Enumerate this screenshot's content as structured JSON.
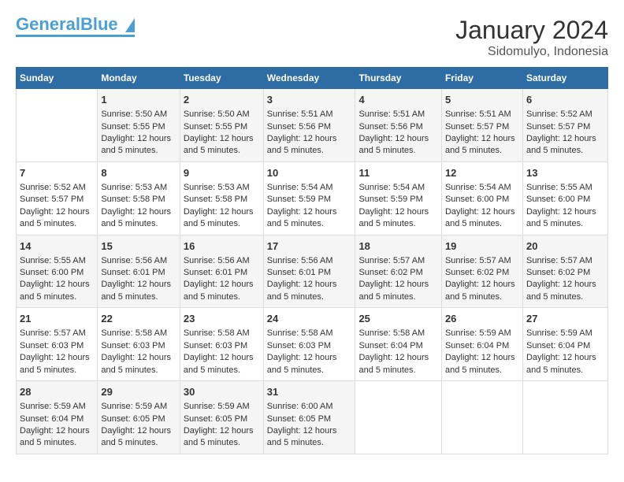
{
  "header": {
    "logo_general": "General",
    "logo_blue": "Blue",
    "month": "January 2024",
    "location": "Sidomulyo, Indonesia"
  },
  "days_of_week": [
    "Sunday",
    "Monday",
    "Tuesday",
    "Wednesday",
    "Thursday",
    "Friday",
    "Saturday"
  ],
  "weeks": [
    [
      {
        "day": "",
        "sunrise": "",
        "sunset": "",
        "daylight": ""
      },
      {
        "day": "1",
        "sunrise": "Sunrise: 5:50 AM",
        "sunset": "Sunset: 5:55 PM",
        "daylight": "Daylight: 12 hours and 5 minutes."
      },
      {
        "day": "2",
        "sunrise": "Sunrise: 5:50 AM",
        "sunset": "Sunset: 5:55 PM",
        "daylight": "Daylight: 12 hours and 5 minutes."
      },
      {
        "day": "3",
        "sunrise": "Sunrise: 5:51 AM",
        "sunset": "Sunset: 5:56 PM",
        "daylight": "Daylight: 12 hours and 5 minutes."
      },
      {
        "day": "4",
        "sunrise": "Sunrise: 5:51 AM",
        "sunset": "Sunset: 5:56 PM",
        "daylight": "Daylight: 12 hours and 5 minutes."
      },
      {
        "day": "5",
        "sunrise": "Sunrise: 5:51 AM",
        "sunset": "Sunset: 5:57 PM",
        "daylight": "Daylight: 12 hours and 5 minutes."
      },
      {
        "day": "6",
        "sunrise": "Sunrise: 5:52 AM",
        "sunset": "Sunset: 5:57 PM",
        "daylight": "Daylight: 12 hours and 5 minutes."
      }
    ],
    [
      {
        "day": "7",
        "sunrise": "Sunrise: 5:52 AM",
        "sunset": "Sunset: 5:57 PM",
        "daylight": "Daylight: 12 hours and 5 minutes."
      },
      {
        "day": "8",
        "sunrise": "Sunrise: 5:53 AM",
        "sunset": "Sunset: 5:58 PM",
        "daylight": "Daylight: 12 hours and 5 minutes."
      },
      {
        "day": "9",
        "sunrise": "Sunrise: 5:53 AM",
        "sunset": "Sunset: 5:58 PM",
        "daylight": "Daylight: 12 hours and 5 minutes."
      },
      {
        "day": "10",
        "sunrise": "Sunrise: 5:54 AM",
        "sunset": "Sunset: 5:59 PM",
        "daylight": "Daylight: 12 hours and 5 minutes."
      },
      {
        "day": "11",
        "sunrise": "Sunrise: 5:54 AM",
        "sunset": "Sunset: 5:59 PM",
        "daylight": "Daylight: 12 hours and 5 minutes."
      },
      {
        "day": "12",
        "sunrise": "Sunrise: 5:54 AM",
        "sunset": "Sunset: 6:00 PM",
        "daylight": "Daylight: 12 hours and 5 minutes."
      },
      {
        "day": "13",
        "sunrise": "Sunrise: 5:55 AM",
        "sunset": "Sunset: 6:00 PM",
        "daylight": "Daylight: 12 hours and 5 minutes."
      }
    ],
    [
      {
        "day": "14",
        "sunrise": "Sunrise: 5:55 AM",
        "sunset": "Sunset: 6:00 PM",
        "daylight": "Daylight: 12 hours and 5 minutes."
      },
      {
        "day": "15",
        "sunrise": "Sunrise: 5:56 AM",
        "sunset": "Sunset: 6:01 PM",
        "daylight": "Daylight: 12 hours and 5 minutes."
      },
      {
        "day": "16",
        "sunrise": "Sunrise: 5:56 AM",
        "sunset": "Sunset: 6:01 PM",
        "daylight": "Daylight: 12 hours and 5 minutes."
      },
      {
        "day": "17",
        "sunrise": "Sunrise: 5:56 AM",
        "sunset": "Sunset: 6:01 PM",
        "daylight": "Daylight: 12 hours and 5 minutes."
      },
      {
        "day": "18",
        "sunrise": "Sunrise: 5:57 AM",
        "sunset": "Sunset: 6:02 PM",
        "daylight": "Daylight: 12 hours and 5 minutes."
      },
      {
        "day": "19",
        "sunrise": "Sunrise: 5:57 AM",
        "sunset": "Sunset: 6:02 PM",
        "daylight": "Daylight: 12 hours and 5 minutes."
      },
      {
        "day": "20",
        "sunrise": "Sunrise: 5:57 AM",
        "sunset": "Sunset: 6:02 PM",
        "daylight": "Daylight: 12 hours and 5 minutes."
      }
    ],
    [
      {
        "day": "21",
        "sunrise": "Sunrise: 5:57 AM",
        "sunset": "Sunset: 6:03 PM",
        "daylight": "Daylight: 12 hours and 5 minutes."
      },
      {
        "day": "22",
        "sunrise": "Sunrise: 5:58 AM",
        "sunset": "Sunset: 6:03 PM",
        "daylight": "Daylight: 12 hours and 5 minutes."
      },
      {
        "day": "23",
        "sunrise": "Sunrise: 5:58 AM",
        "sunset": "Sunset: 6:03 PM",
        "daylight": "Daylight: 12 hours and 5 minutes."
      },
      {
        "day": "24",
        "sunrise": "Sunrise: 5:58 AM",
        "sunset": "Sunset: 6:03 PM",
        "daylight": "Daylight: 12 hours and 5 minutes."
      },
      {
        "day": "25",
        "sunrise": "Sunrise: 5:58 AM",
        "sunset": "Sunset: 6:04 PM",
        "daylight": "Daylight: 12 hours and 5 minutes."
      },
      {
        "day": "26",
        "sunrise": "Sunrise: 5:59 AM",
        "sunset": "Sunset: 6:04 PM",
        "daylight": "Daylight: 12 hours and 5 minutes."
      },
      {
        "day": "27",
        "sunrise": "Sunrise: 5:59 AM",
        "sunset": "Sunset: 6:04 PM",
        "daylight": "Daylight: 12 hours and 5 minutes."
      }
    ],
    [
      {
        "day": "28",
        "sunrise": "Sunrise: 5:59 AM",
        "sunset": "Sunset: 6:04 PM",
        "daylight": "Daylight: 12 hours and 5 minutes."
      },
      {
        "day": "29",
        "sunrise": "Sunrise: 5:59 AM",
        "sunset": "Sunset: 6:05 PM",
        "daylight": "Daylight: 12 hours and 5 minutes."
      },
      {
        "day": "30",
        "sunrise": "Sunrise: 5:59 AM",
        "sunset": "Sunset: 6:05 PM",
        "daylight": "Daylight: 12 hours and 5 minutes."
      },
      {
        "day": "31",
        "sunrise": "Sunrise: 6:00 AM",
        "sunset": "Sunset: 6:05 PM",
        "daylight": "Daylight: 12 hours and 5 minutes."
      },
      {
        "day": "",
        "sunrise": "",
        "sunset": "",
        "daylight": ""
      },
      {
        "day": "",
        "sunrise": "",
        "sunset": "",
        "daylight": ""
      },
      {
        "day": "",
        "sunrise": "",
        "sunset": "",
        "daylight": ""
      }
    ]
  ]
}
